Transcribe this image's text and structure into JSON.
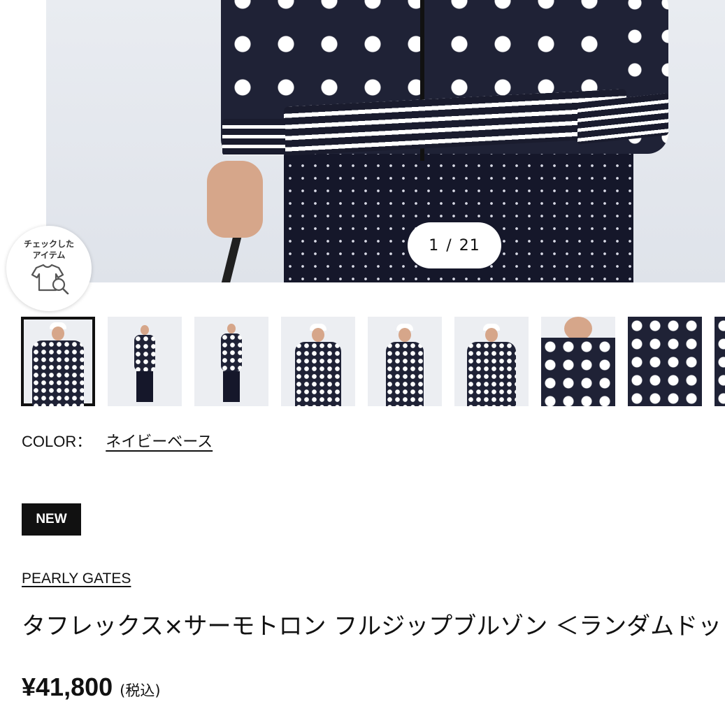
{
  "gallery": {
    "current": "1",
    "separator": "/",
    "total": "21",
    "thumbnail_count": 9
  },
  "checked_items": {
    "line1": "チェックした",
    "line2": "アイテム",
    "icon": "tshirt-search-icon"
  },
  "product": {
    "color_label": "COLOR：",
    "color_value": "ネイビーベース",
    "badge": "NEW",
    "brand": "PEARLY GATES",
    "title": "タフレックス×サーモトロン フルジップブルゾン ＜ランダムドット",
    "price": "¥41,800",
    "tax_note": "(税込)"
  },
  "colors": {
    "navy": "#1f2236",
    "black": "#111111",
    "background": "#ffffff"
  }
}
